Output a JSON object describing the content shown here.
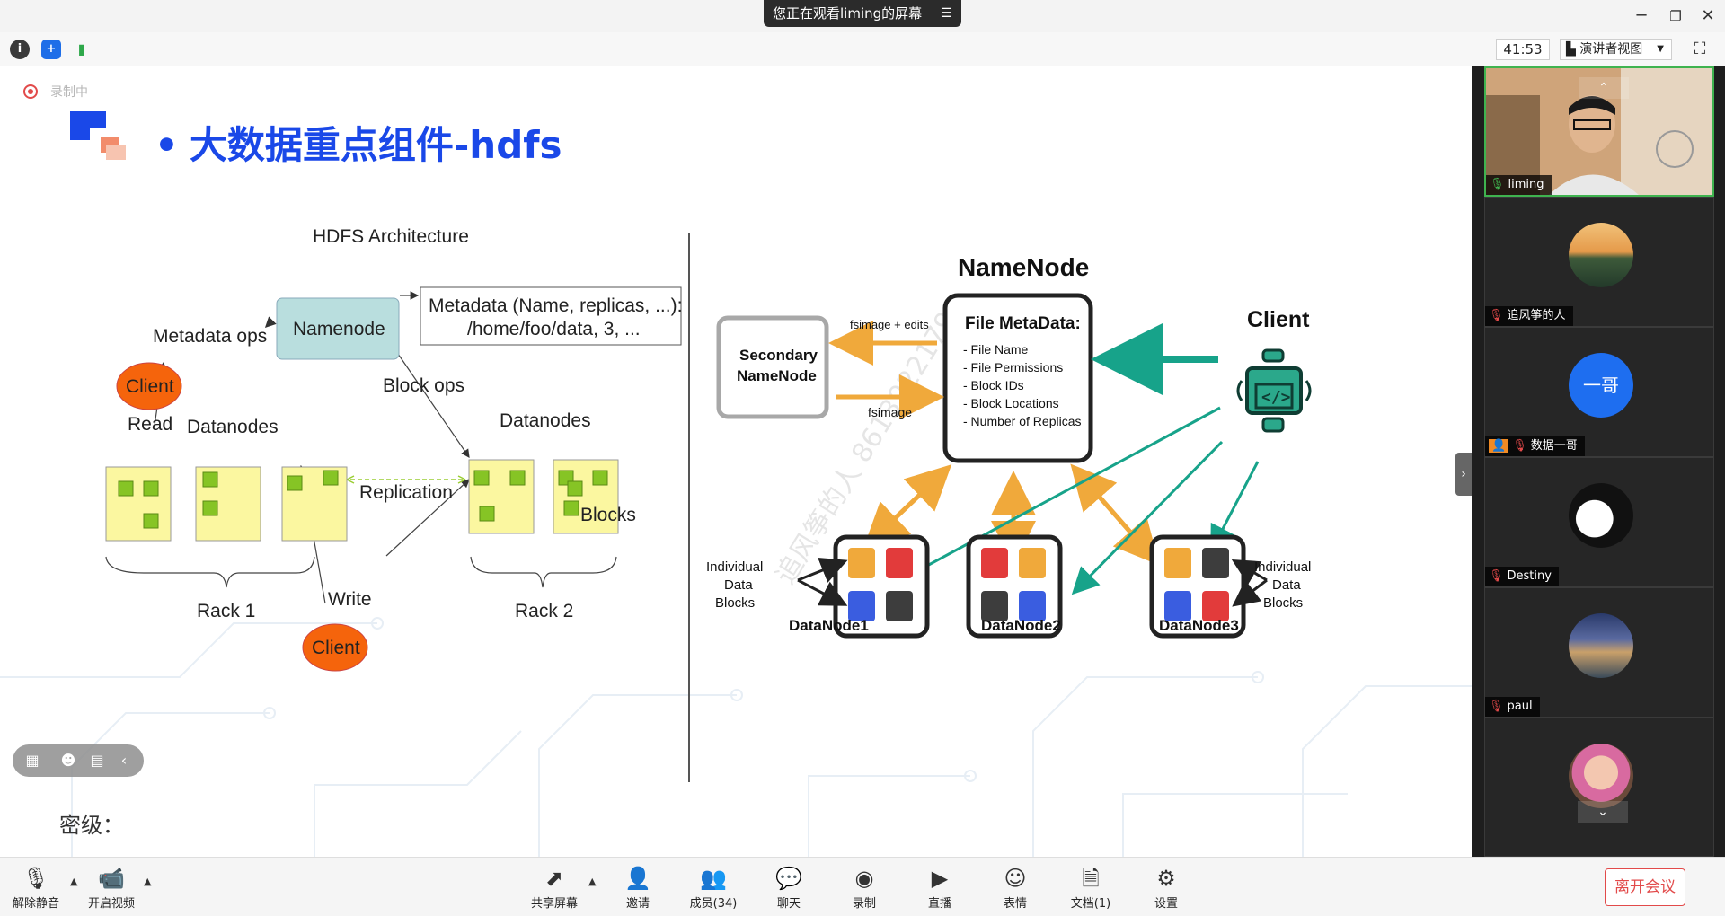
{
  "window": {
    "share_banner": "您正在观看liming的屏幕",
    "timer": "41:53",
    "presenter_view": "演讲者视图"
  },
  "slide": {
    "recording": "录制中",
    "title": "大数据重点组件-hdfs",
    "secret_label": "密级：",
    "watermark": "追风筝的人 8613922179"
  },
  "hdfs_diagram": {
    "heading": "HDFS Architecture",
    "namenode": "Namenode",
    "metadata_line1": "Metadata (Name, replicas, ...):",
    "metadata_line2": "/home/foo/data, 3, ...",
    "metadata_ops": "Metadata ops",
    "client_top": "Client",
    "block_ops": "Block ops",
    "read": "Read",
    "datanodes_left": "Datanodes",
    "datanodes_right": "Datanodes",
    "replication": "Replication",
    "blocks": "Blocks",
    "rack1": "Rack 1",
    "rack2": "Rack 2",
    "write": "Write",
    "client_bottom": "Client"
  },
  "namenode_diagram": {
    "namenode_title": "NameNode",
    "file_metadata": "File MetaData:",
    "items": [
      "- File Name",
      "- File Permissions",
      "- Block IDs",
      "- Block Locations",
      "- Number of Replicas"
    ],
    "secondary_line1": "Secondary",
    "secondary_line2": "NameNode",
    "fsimage_edits": "fsimage + edits",
    "fsimage": "fsimage",
    "client": "Client",
    "individual_left": [
      "Individual",
      "Data",
      "Blocks"
    ],
    "individual_right": [
      "Individual",
      "Data",
      "Blocks"
    ],
    "datanode1": "DataNode1",
    "datanode2": "DataNode2",
    "datanode3": "DataNode3",
    "colors": {
      "orange": "#f0a93b",
      "teal": "#17a38a",
      "red": "#e23b3b",
      "blue": "#3a5de0",
      "dark": "#3d3d3d",
      "green": "#2ba88b"
    }
  },
  "participants": [
    {
      "name": "liming",
      "type": "video",
      "mic": "on"
    },
    {
      "name": "追风筝的人",
      "type": "avatar-lake",
      "mic": "off"
    },
    {
      "name": "数据一哥",
      "avatar_text": "一哥",
      "type": "avatar-text",
      "mic": "off"
    },
    {
      "name": "Destiny",
      "type": "avatar-bw",
      "mic": "off"
    },
    {
      "name": "paul",
      "type": "avatar-city",
      "mic": "off"
    },
    {
      "name": "",
      "type": "avatar-child",
      "mic": "off"
    }
  ],
  "controls": {
    "unmute": "解除静音",
    "start_video": "开启视频",
    "share": "共享屏幕",
    "invite": "邀请",
    "members": "成员(34)",
    "chat": "聊天",
    "record": "录制",
    "live": "直播",
    "reactions": "表情",
    "docs": "文档(1)",
    "settings": "设置",
    "leave": "离开会议"
  }
}
